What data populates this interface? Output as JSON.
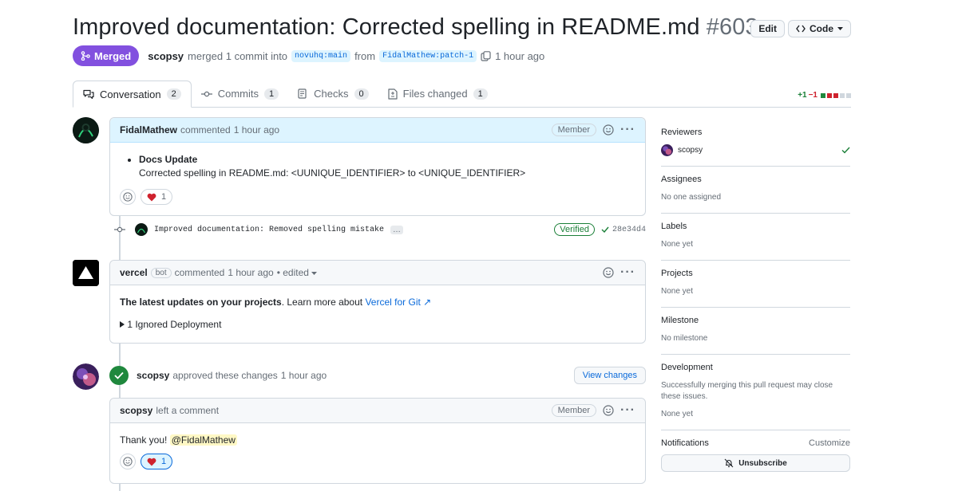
{
  "header": {
    "title": "Improved documentation: Corrected spelling in README.md",
    "number": "#603",
    "edit_label": "Edit",
    "code_label": "Code"
  },
  "meta": {
    "status": "Merged",
    "merger": "scopsy",
    "merged_text": "merged 1 commit into",
    "base_branch": "novuhq:main",
    "from_text": "from",
    "head_branch": "FidalMathew:patch-1",
    "time": "1 hour ago"
  },
  "tabs": [
    {
      "label": "Conversation",
      "count": "2"
    },
    {
      "label": "Commits",
      "count": "1"
    },
    {
      "label": "Checks",
      "count": "0"
    },
    {
      "label": "Files changed",
      "count": "1"
    }
  ],
  "diffstat": {
    "additions": "+1",
    "deletions": "−1"
  },
  "comment1": {
    "author": "FidalMathew",
    "action": "commented",
    "time": "1 hour ago",
    "role": "Member",
    "bullet_title": "Docs Update",
    "bullet_text": "Corrected spelling in README.md: <UUNIQUE_IDENTIFIER> to <UNIQUE_IDENTIFIER>",
    "reaction_count": "1"
  },
  "commit": {
    "message": "Improved documentation: Removed spelling mistake",
    "ellipsis": "…",
    "verified": "Verified",
    "sha": "28e34d4"
  },
  "comment2": {
    "author": "vercel",
    "badge": "bot",
    "action": "commented",
    "time": "1 hour ago",
    "edited": "• edited",
    "line1_bold": "The latest updates on your projects",
    "line1_rest": ". Learn more about",
    "line1_link": "Vercel for Git ↗",
    "summary": "1 Ignored Deployment"
  },
  "review": {
    "author": "scopsy",
    "text": "approved these changes",
    "time": "1 hour ago",
    "button": "View changes"
  },
  "comment3": {
    "author": "scopsy",
    "action": "left a comment",
    "role": "Member",
    "text": "Thank you!",
    "mention": "@FidalMathew",
    "reaction_count": "1"
  },
  "sidebar": {
    "reviewers_title": "Reviewers",
    "reviewer": "scopsy",
    "assignees_title": "Assignees",
    "assignees_value": "No one assigned",
    "labels_title": "Labels",
    "labels_value": "None yet",
    "projects_title": "Projects",
    "projects_value": "None yet",
    "milestone_title": "Milestone",
    "milestone_value": "No milestone",
    "development_title": "Development",
    "development_text": "Successfully merging this pull request may close these issues.",
    "development_value": "None yet",
    "notifications_title": "Notifications",
    "customize": "Customize",
    "unsubscribe": "Unsubscribe"
  },
  "colors": {
    "merged": "#8250df",
    "link": "#0969da",
    "success": "#1f883d",
    "danger": "#cf222e"
  }
}
